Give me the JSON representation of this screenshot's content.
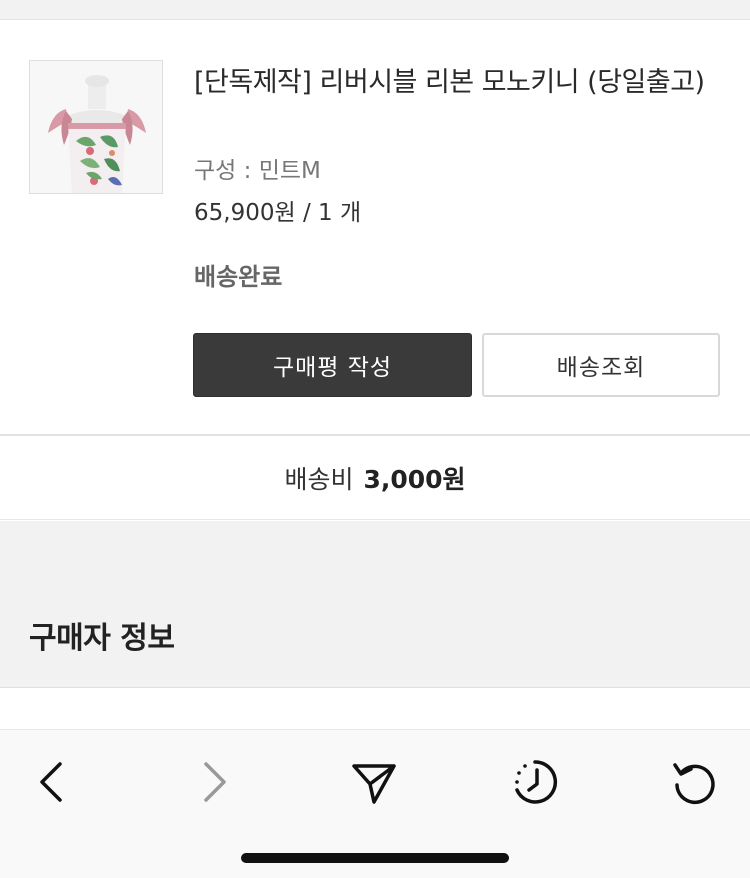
{
  "order_item": {
    "name": "[단독제작] 리버시블 리본 모노키니 (당일출고)",
    "option": "구성 : 민트M",
    "price": "65,900원 / 1 개",
    "status": "배송완료",
    "review_button": "구매평 작성",
    "track_button": "배송조회"
  },
  "shipping": {
    "label": "배송비",
    "amount": "3,000원"
  },
  "buyer_section": {
    "title": "구매자 정보"
  },
  "browser_toolbar": {
    "back_icon": "chevron-left-icon",
    "forward_icon": "chevron-right-icon",
    "share_icon": "paper-plane-icon",
    "history_icon": "clock-history-icon",
    "reload_icon": "reload-icon"
  },
  "colors": {
    "primary_button_bg": "#3a3a3a",
    "section_bg": "#f2f2f2",
    "forward_disabled": "#999999"
  }
}
